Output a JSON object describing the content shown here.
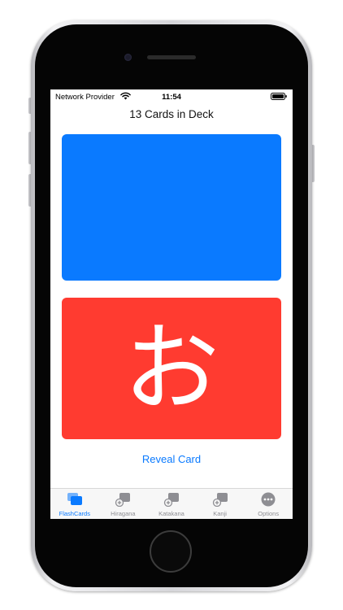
{
  "status_bar": {
    "carrier": "Network Provider",
    "time": "11:54"
  },
  "deck": {
    "title": "13 Cards in Deck"
  },
  "cards": {
    "top_color": "#0a7aff",
    "bottom_color": "#ff3b30",
    "bottom_glyph": "お"
  },
  "reveal": {
    "label": "Reveal Card",
    "color": "#0a7aff"
  },
  "tabs": [
    {
      "label": "FlashCards",
      "icon": "flashcards-icon",
      "active": true
    },
    {
      "label": "Hiragana",
      "icon": "add-card-icon",
      "active": false
    },
    {
      "label": "Katakana",
      "icon": "add-card-icon",
      "active": false
    },
    {
      "label": "Kanji",
      "icon": "add-card-icon",
      "active": false
    },
    {
      "label": "Options",
      "icon": "more-icon",
      "active": false
    }
  ],
  "colors": {
    "tab_active": "#0a7aff",
    "tab_inactive": "#8e8e93"
  }
}
